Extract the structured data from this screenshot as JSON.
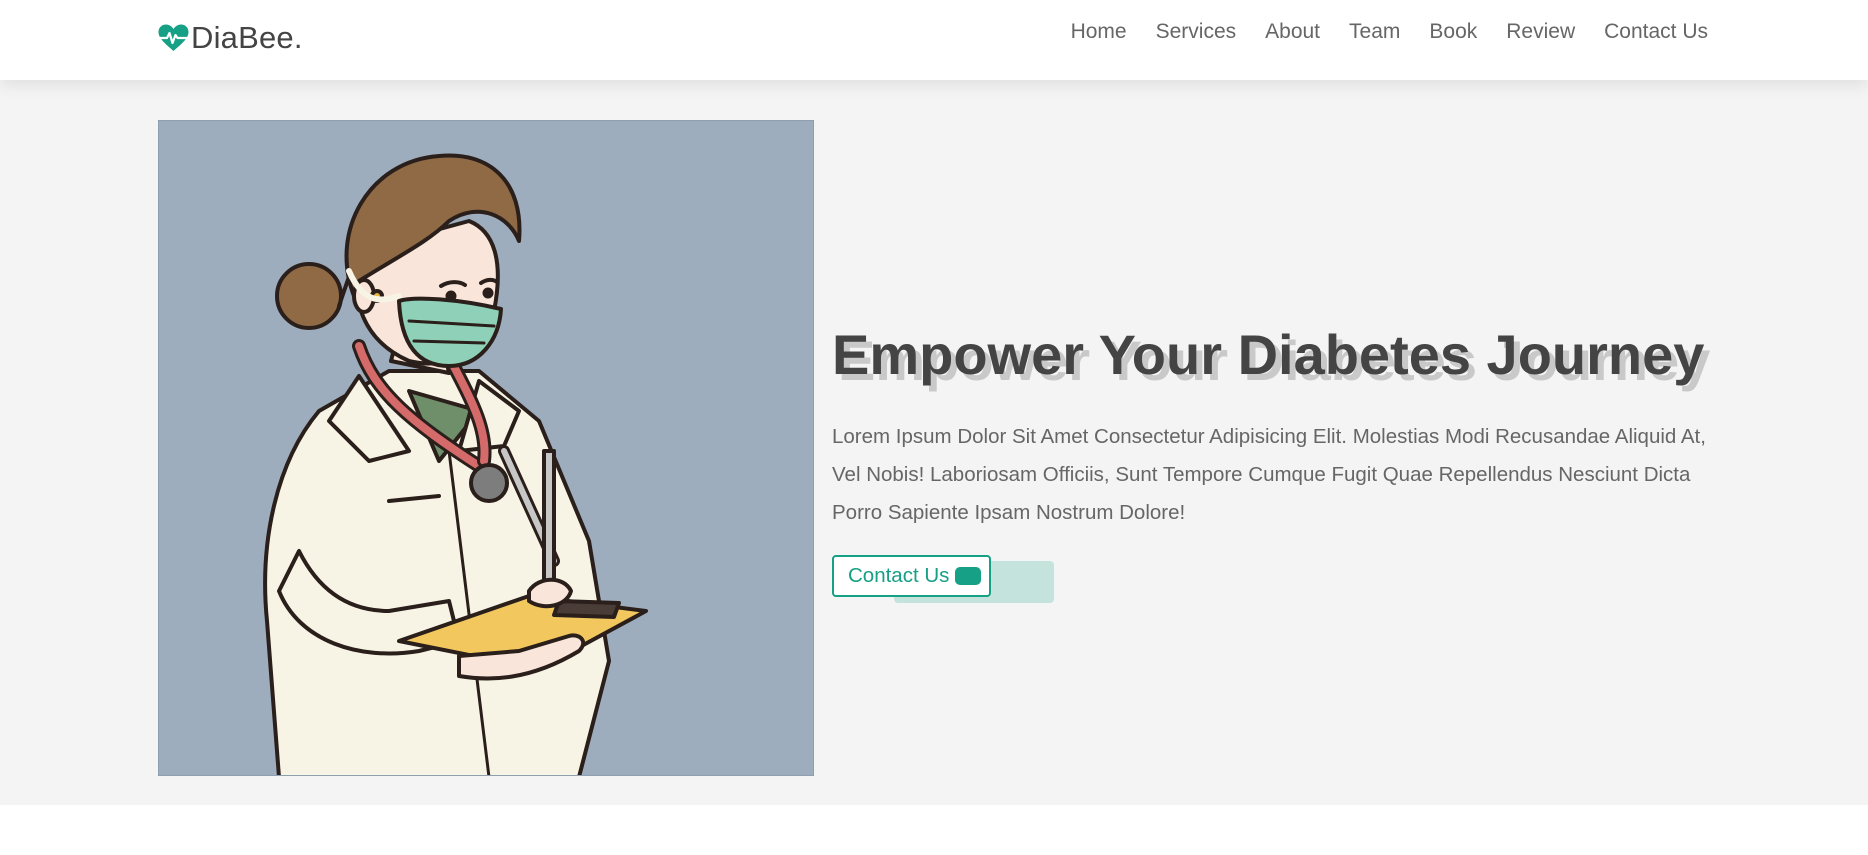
{
  "header": {
    "logo_text": "DiaBee",
    "logo_dot": ".",
    "logo_icon": "heart-pulse-icon",
    "nav": [
      {
        "label": "Home"
      },
      {
        "label": "Services"
      },
      {
        "label": "About"
      },
      {
        "label": "Team"
      },
      {
        "label": "Book"
      },
      {
        "label": "Review"
      },
      {
        "label": "Contact Us"
      }
    ]
  },
  "hero": {
    "title": "Empower Your Diabetes Journey",
    "text": "Lorem Ipsum Dolor Sit Amet Consectetur Adipisicing Elit. Molestias Modi Recusandae Aliquid At, Vel Nobis! Laboriosam Officiis, Sunt Tempore Cumque Fugit Quae Repellendus Nesciunt Dicta Porro Sapiente Ipsam Nostrum Dolore!",
    "button_label": "Contact Us",
    "image": "doctor-illustration"
  },
  "colors": {
    "accent": "#16a085",
    "text_dark": "#444444",
    "text_muted": "#666666",
    "hero_bg": "#f4f4f4",
    "image_bg": "#9eadbd"
  }
}
